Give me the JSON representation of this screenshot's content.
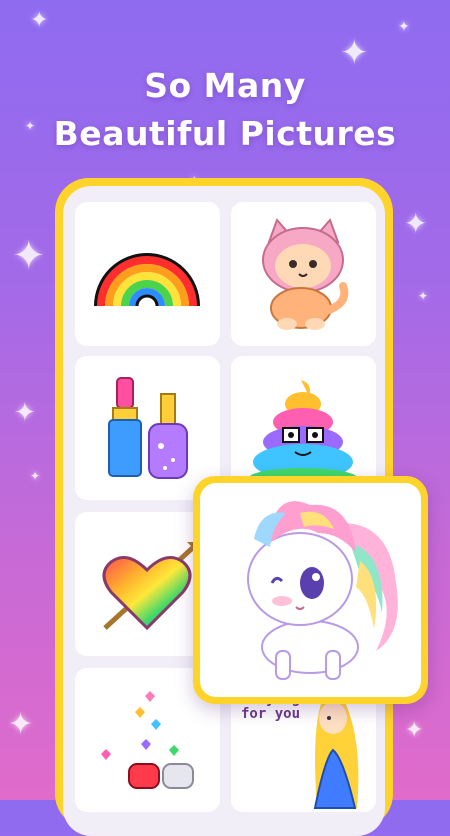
{
  "headline": {
    "line1": "So Many",
    "line2": "Beautiful Pictures"
  },
  "gallery": [
    {
      "name": "rainbow-icon"
    },
    {
      "name": "cat-hoodie-icon"
    },
    {
      "name": "lipstick-nailpolish-icon"
    },
    {
      "name": "rainbow-poop-icon"
    },
    {
      "name": "heart-arrow-icon"
    },
    {
      "name": "unicorn-pony-icon"
    },
    {
      "name": "hearts-gems-icon"
    },
    {
      "name": "princess-icon"
    }
  ],
  "princess_card": {
    "caption_line1": "Praying",
    "caption_line2": "for you"
  },
  "colors": {
    "frame": "#ffd42a",
    "background_top": "#8f6bf0",
    "background_bottom": "#e06bcb"
  }
}
